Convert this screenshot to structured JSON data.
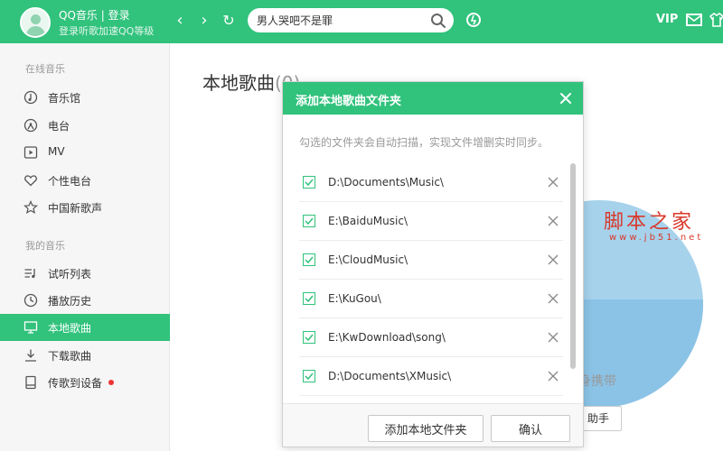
{
  "header": {
    "user_title": "QQ音乐 | 登录",
    "user_subtitle": "登录听歌加速QQ等级",
    "back_glyph": "‹",
    "forward_glyph": "›",
    "refresh_glyph": "↻",
    "search_value": "男人哭吧不是罪",
    "vip_label": "VIP",
    "icons": [
      "avatar",
      "back-icon",
      "forward-icon",
      "refresh-icon",
      "search-icon",
      "recognize-icon",
      "mail-icon",
      "tshirt-icon"
    ],
    "accent_color": "#31c27c"
  },
  "sidebar": {
    "online_title": "在线音乐",
    "online_items": [
      {
        "label": "音乐馆",
        "icon": "music-hall-icon"
      },
      {
        "label": "电台",
        "icon": "radio-icon"
      },
      {
        "label": "MV",
        "icon": "mv-icon"
      },
      {
        "label": "个性电台",
        "icon": "heart-icon"
      },
      {
        "label": "中国新歌声",
        "icon": "star-icon"
      }
    ],
    "mine_title": "我的音乐",
    "mine_items": [
      {
        "label": "试听列表",
        "icon": "playlist-icon"
      },
      {
        "label": "播放历史",
        "icon": "clock-icon"
      },
      {
        "label": "本地歌曲",
        "icon": "monitor-icon",
        "active": true
      },
      {
        "label": "下载歌曲",
        "icon": "download-icon"
      },
      {
        "label": "传歌到设备",
        "icon": "device-icon",
        "has_dot": true
      }
    ]
  },
  "main": {
    "page_title": "本地歌曲",
    "song_count": "(0)",
    "bg_carry_text": "身携带",
    "bg_helper_label": "助手"
  },
  "dialog": {
    "title": "添加本地歌曲文件夹",
    "description": "勾选的文件夹会自动扫描，实现文件增删实时同步。",
    "folders": [
      {
        "path": "D:\\Documents\\Music\\",
        "checked": true
      },
      {
        "path": "E:\\BaiduMusic\\",
        "checked": true
      },
      {
        "path": "E:\\CloudMusic\\",
        "checked": true
      },
      {
        "path": "E:\\KuGou\\",
        "checked": true
      },
      {
        "path": "E:\\KwDownload\\song\\",
        "checked": true
      },
      {
        "path": "D:\\Documents\\XMusic\\",
        "checked": true
      }
    ],
    "add_folder_button": "添加本地文件夹",
    "confirm_button": "确认"
  },
  "watermark": {
    "text": "脚本之家",
    "url": "www.jb51.net"
  }
}
